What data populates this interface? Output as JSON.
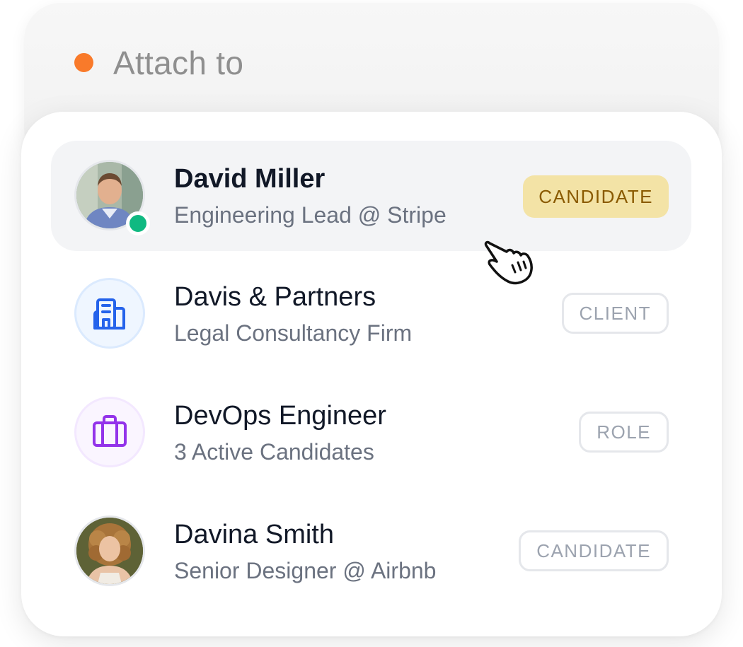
{
  "header": {
    "label": "Attach to",
    "dot_color": "#f97a2a"
  },
  "items": [
    {
      "title": "David Miller",
      "subtitle": "Engineering Lead @ Stripe",
      "badge": "CANDIDATE",
      "avatar": "photo",
      "online": true,
      "selected": true
    },
    {
      "title": "Davis & Partners",
      "subtitle": "Legal Consultancy Firm",
      "badge": "CLIENT",
      "avatar": "building-icon",
      "selected": false
    },
    {
      "title": "DevOps Engineer",
      "subtitle": "3 Active Candidates",
      "badge": "ROLE",
      "avatar": "briefcase-icon",
      "selected": false
    },
    {
      "title": "Davina Smith",
      "subtitle": "Senior Designer @ Airbnb",
      "badge": "CANDIDATE",
      "avatar": "photo",
      "selected": false
    }
  ],
  "colors": {
    "selected_badge_bg": "#f3e3a6",
    "selected_badge_text": "#8a5a00",
    "online": "#10b981",
    "building_icon": "#2563eb",
    "briefcase_icon": "#9333ea"
  },
  "cursor": "pointer-hand-icon"
}
